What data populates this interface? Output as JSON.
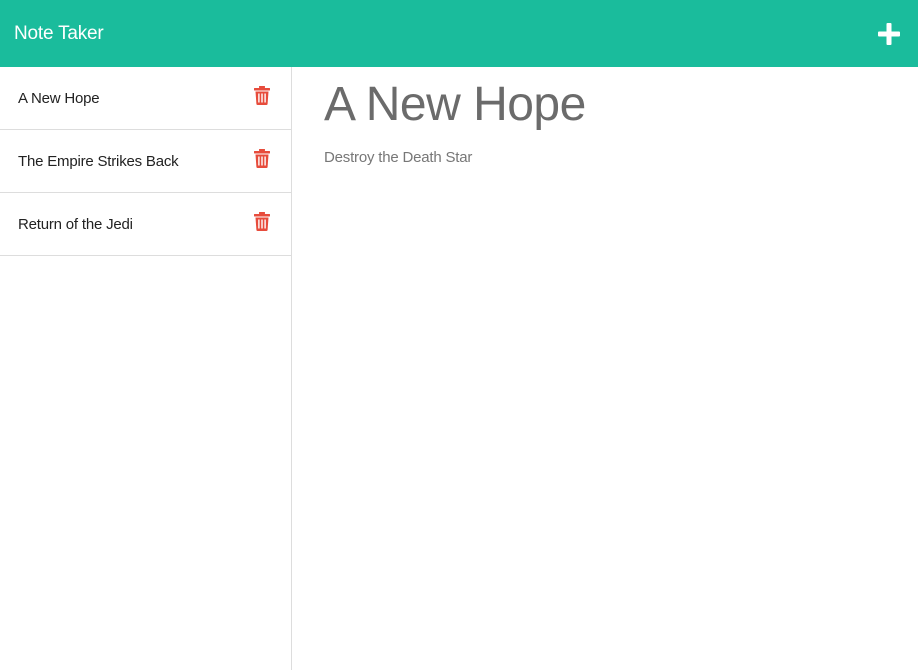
{
  "header": {
    "brand": "Note Taker",
    "add_icon": "plus-icon",
    "background_color": "#1abc9c"
  },
  "sidebar": {
    "items": [
      {
        "label": "A New Hope",
        "icon": "trash-icon"
      },
      {
        "label": "The Empire Strikes Back",
        "icon": "trash-icon"
      },
      {
        "label": "Return of the Jedi",
        "icon": "trash-icon"
      }
    ],
    "delete_icon_color": "#e74c3c"
  },
  "main": {
    "title": "A New Hope",
    "body": "Destroy the Death Star"
  }
}
